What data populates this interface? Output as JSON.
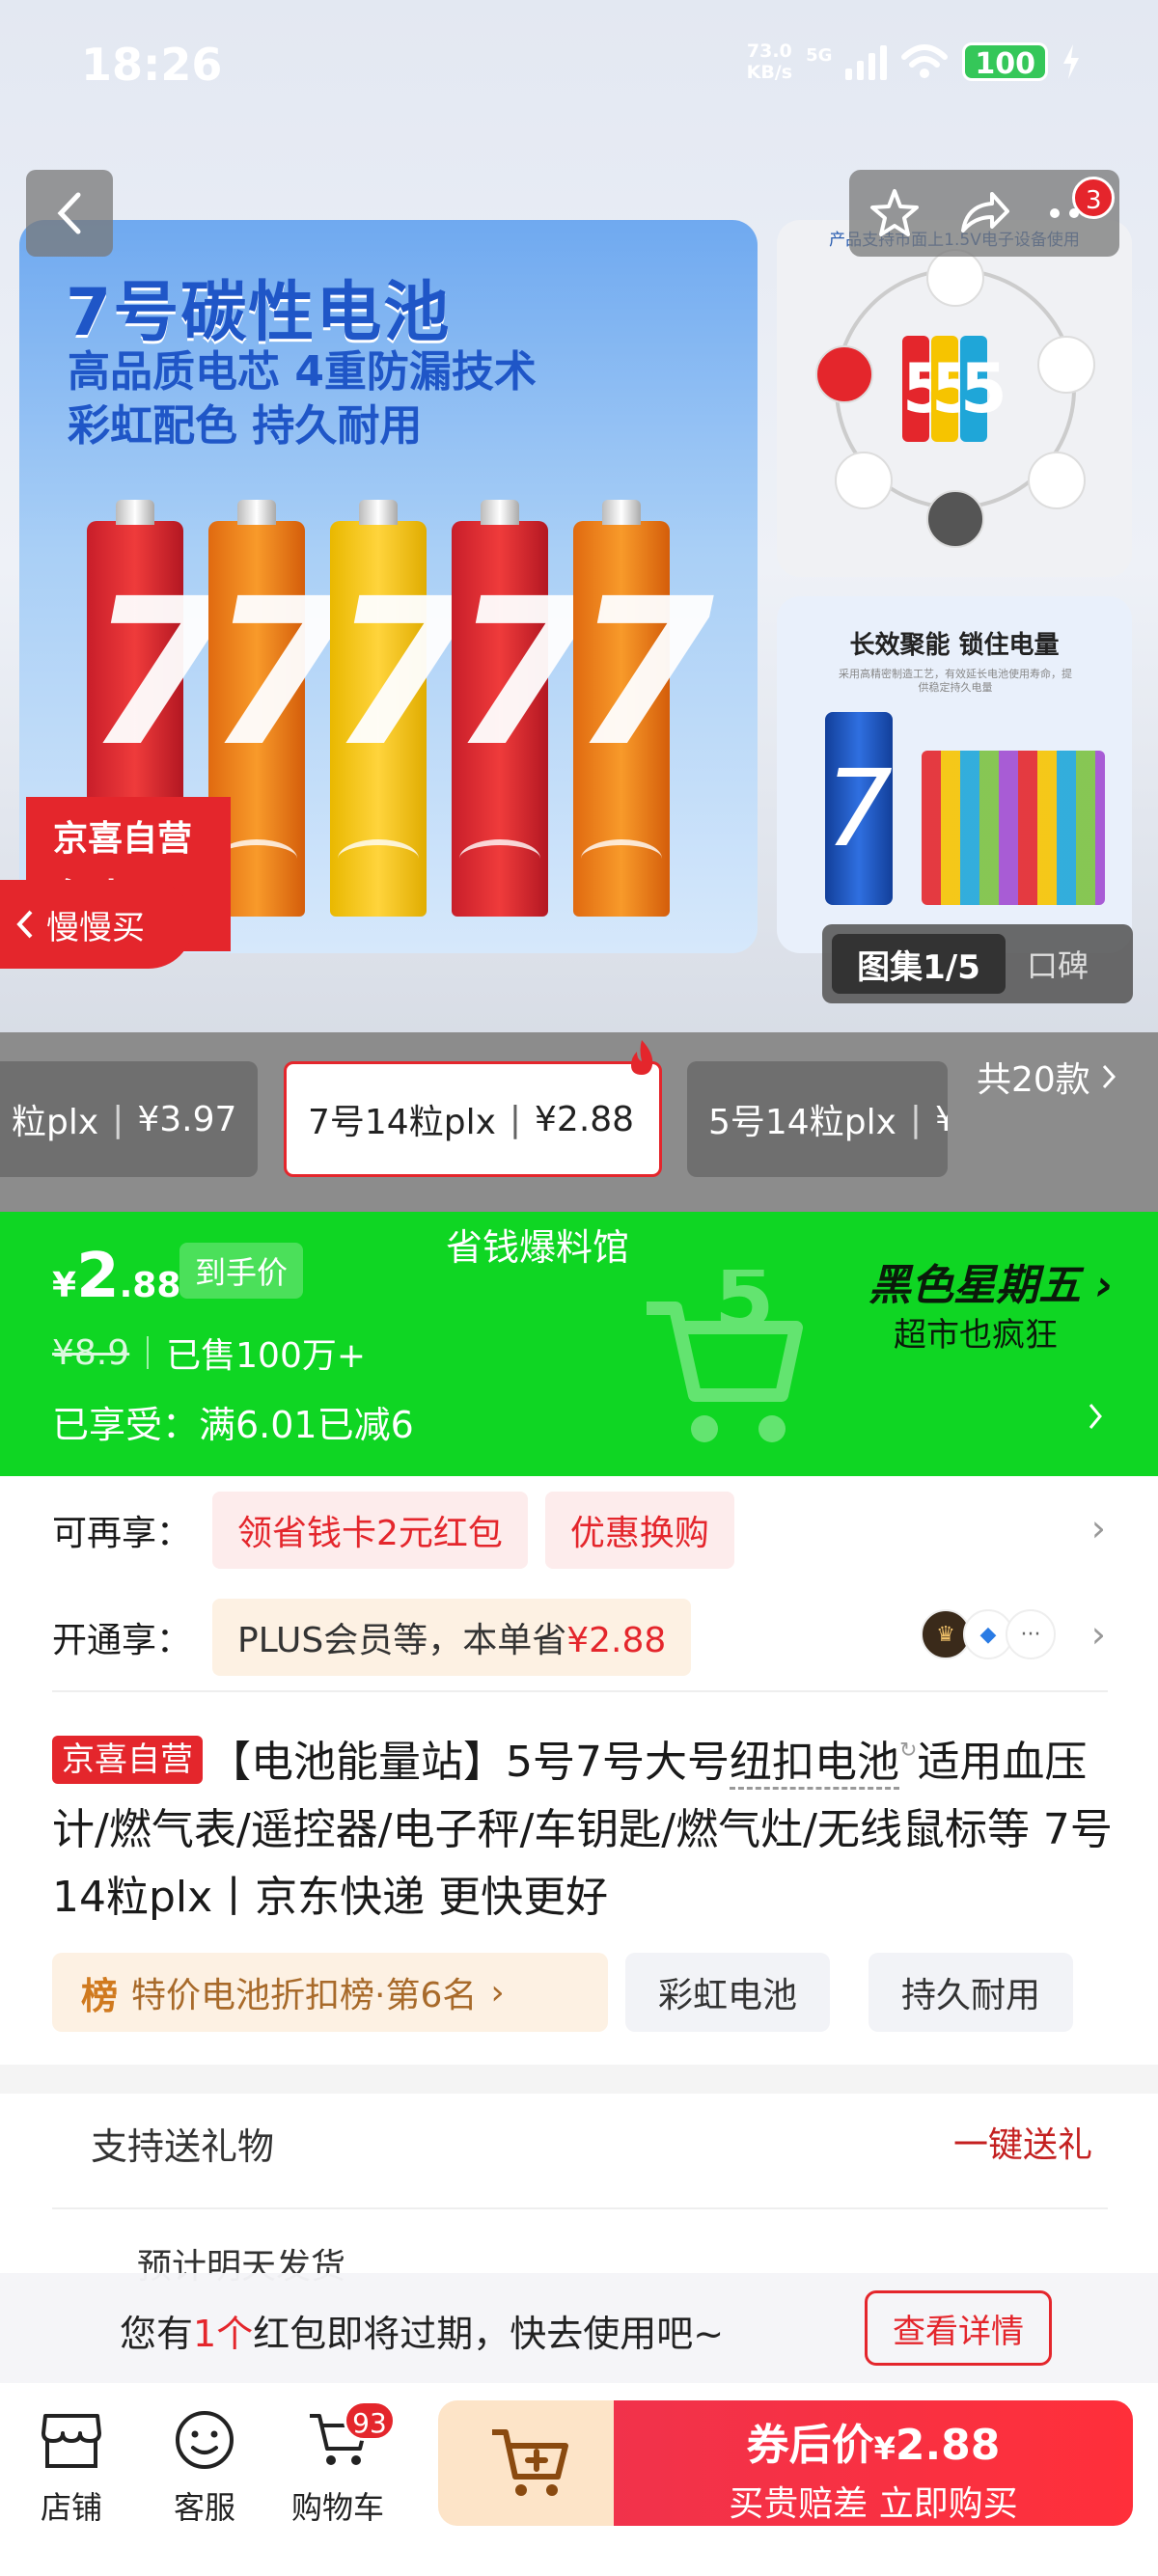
{
  "status_bar": {
    "time": "18:26",
    "net_speed_value": "73.0",
    "net_speed_unit": "KB/s",
    "network": "5G",
    "battery": "100"
  },
  "hero": {
    "main_title": "7号碳性电池",
    "main_line1": "高品质电芯  4重防漏技术",
    "main_line2": "彩虹配色  持久耐用",
    "sticker_line1": "京喜自营",
    "sticker_line2": "包邮",
    "slow_buy": "慢慢买",
    "side1_caption": "产品支持市面上1.5V电子设备使用",
    "side2_heading": "长效聚能 锁住电量",
    "side2_sub": "采用高精密制造工艺，有效延长电池使用寿命，提供稳定持久电量",
    "gallery_label": "图集1/5",
    "review_label": "口碑",
    "cart_badge_top": "3"
  },
  "sku": {
    "items": [
      {
        "name": "粒plx",
        "price": "¥3.97"
      },
      {
        "name": "7号14粒plx",
        "price": "¥2.88"
      },
      {
        "name": "5号14粒plx",
        "price": "¥"
      }
    ],
    "total": "共20款"
  },
  "price_banner": {
    "title": "省钱爆料馆",
    "currency": "¥",
    "price_int": "2",
    "price_dec": ".88",
    "price_tag": "到手价",
    "old_price": "¥8.9",
    "sold": "已售100万+",
    "discount": "已享受：满6.01已减6",
    "promo_title": "黑色星期五",
    "promo_sub": "超市也疯狂"
  },
  "promos": {
    "row1_label": "可再享：",
    "row1_pills": [
      "领省钱卡2元红包",
      "优惠换购"
    ],
    "row2_label": "开通享：",
    "row2_text": "PLUS会员等，本单省",
    "row2_amount": "¥2.88"
  },
  "product": {
    "badge": "京喜自营",
    "title_a": "【电池能量站】5号7号大号",
    "title_dotted": "纽扣电池",
    "title_b": "适用血压计/燃气表/遥控器/电子秤/车钥匙/燃气灶/无线鼠标等 7号14粒plx丨京东快递 更快更好",
    "rank_icon": "榜",
    "rank_text": "特价电池折扣榜·第6名",
    "tags": [
      "彩虹电池",
      "持久耐用"
    ]
  },
  "service": {
    "gift_label": "支持送礼物",
    "gift_link": "一键送礼",
    "ship_text": "预计明天发货"
  },
  "toast": {
    "prefix": "您有",
    "count": "1个",
    "suffix": "红包即将过期，快去使用吧~",
    "button": "查看详情"
  },
  "bottom_bar": {
    "shop": "店铺",
    "service": "客服",
    "cart": "购物车",
    "cart_count": "93",
    "buy_line1": "券后价",
    "buy_currency": "¥",
    "buy_price": "2.88",
    "buy_line2": "买贵赔差 立即购买"
  },
  "colors": {
    "accent_red": "#e4262c",
    "banner_green": "#0fd623"
  }
}
